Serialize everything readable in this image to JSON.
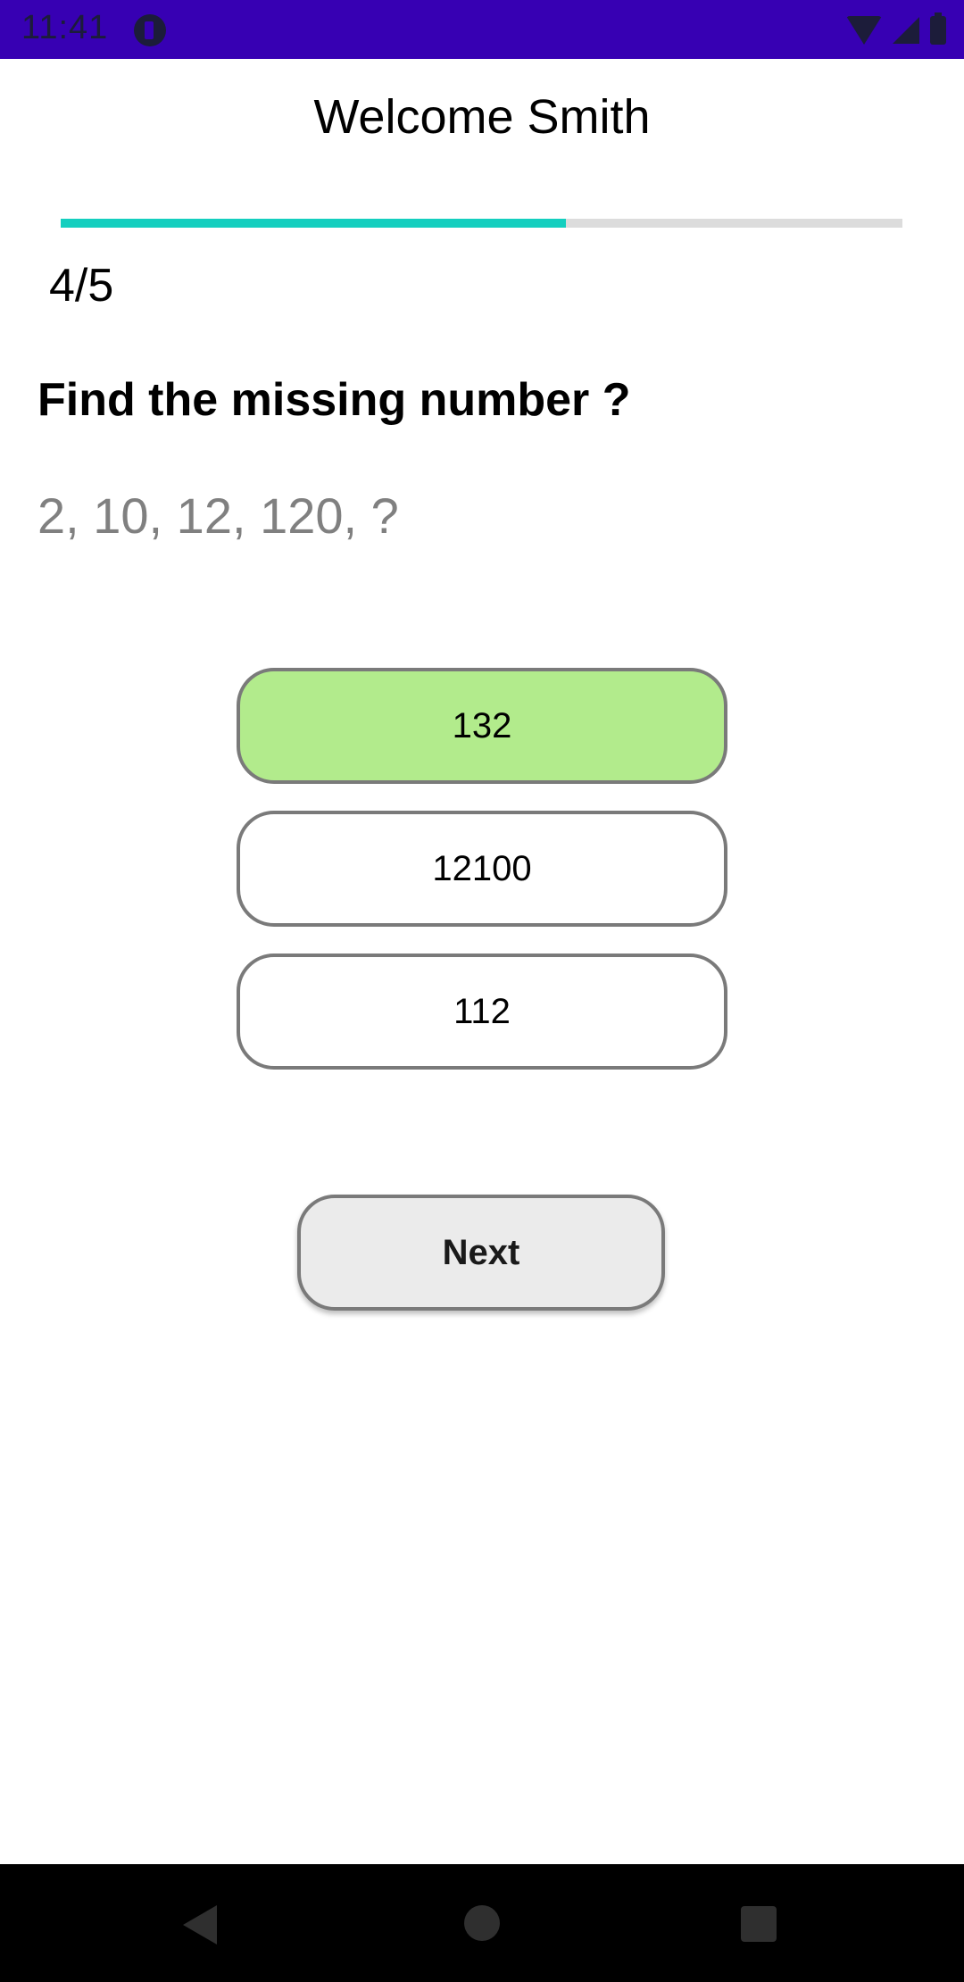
{
  "status_bar": {
    "time": "11:41",
    "icons": [
      "app-notification-icon",
      "wifi-icon",
      "signal-icon",
      "battery-icon"
    ],
    "background_color": "#3700b3"
  },
  "header": {
    "title": "Welcome Smith"
  },
  "progress": {
    "fraction": 0.6,
    "count_label": "4/5",
    "fill_color": "#14cfbf",
    "track_color": "#dcdcdc"
  },
  "question": {
    "title": "Find the missing number ?",
    "sequence": "2, 10, 12, 120, ?"
  },
  "options": [
    {
      "label": "132",
      "selected": true
    },
    {
      "label": "12100",
      "selected": false
    },
    {
      "label": "112",
      "selected": false
    }
  ],
  "selected_color": "#b2eb8c",
  "actions": {
    "next_label": "Next"
  },
  "nav_bar": {
    "icons": [
      "back-icon",
      "home-icon",
      "recents-icon"
    ]
  }
}
